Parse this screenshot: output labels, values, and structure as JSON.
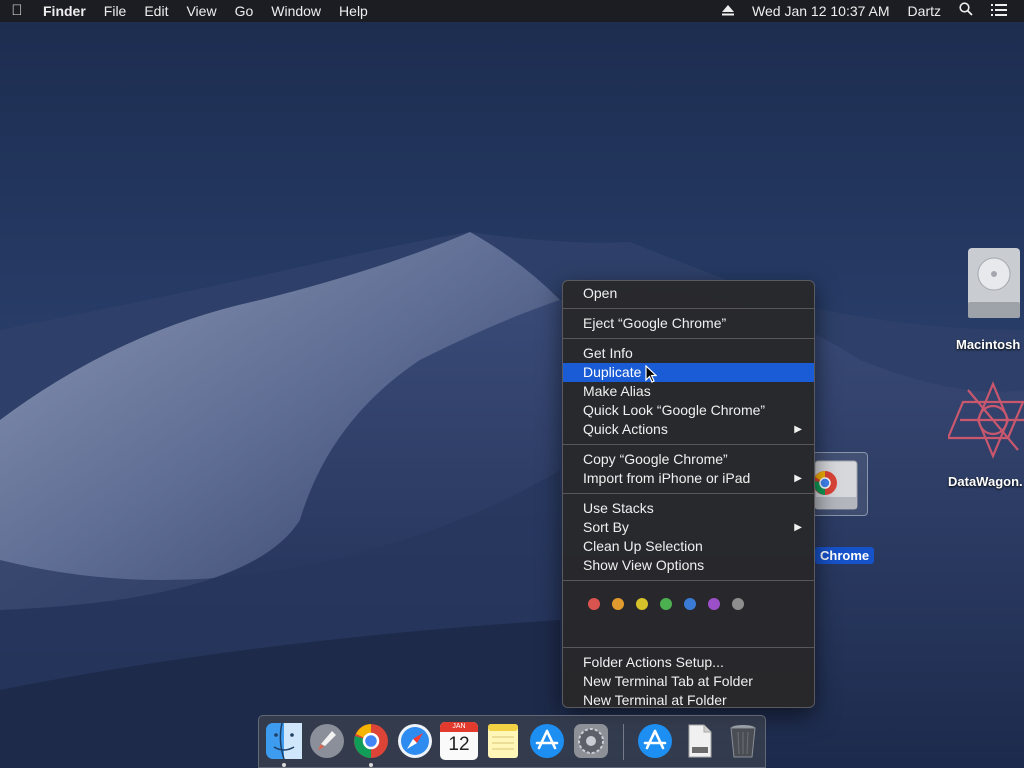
{
  "menubar": {
    "apple_icon": "apple-icon",
    "app_name": "Finder",
    "items": [
      "File",
      "Edit",
      "View",
      "Go",
      "Window",
      "Help"
    ],
    "eject_icon": "eject-icon",
    "datetime": "Wed Jan 12  10:37 AM",
    "user": "Dartz",
    "search_icon": "search-icon",
    "notification_icon": "list-icon"
  },
  "desktop": {
    "icons": [
      {
        "label": "Macintosh",
        "icon": "hard-drive-icon"
      },
      {
        "label": "DataWagon.",
        "icon": "datawagon-icon"
      },
      {
        "label": "Chrome",
        "icon": "chrome-disk-icon",
        "selected": true
      }
    ]
  },
  "context_menu": {
    "open": "Open",
    "eject": "Eject “Google Chrome”",
    "get_info": "Get Info",
    "duplicate": "Duplicate",
    "make_alias": "Make Alias",
    "quick_look": "Quick Look “Google Chrome”",
    "quick_actions": "Quick Actions",
    "copy": "Copy “Google Chrome”",
    "import": "Import from iPhone or iPad",
    "use_stacks": "Use Stacks",
    "sort_by": "Sort By",
    "clean_up": "Clean Up Selection",
    "show_view_options": "Show View Options",
    "tags": [
      "#d9534f",
      "#e09a2d",
      "#d6c22a",
      "#4caf50",
      "#3a7bd5",
      "#9c4fc9",
      "#8e8e8e"
    ],
    "folder_actions": "Folder Actions Setup...",
    "new_terminal_tab": "New Terminal Tab at Folder",
    "new_terminal": "New Terminal at Folder",
    "highlighted": "Duplicate",
    "highlight_color": "#1a5cd6"
  },
  "dock": {
    "apps": [
      "finder-icon",
      "launchpad-icon",
      "chrome-icon",
      "safari-icon",
      "calendar-icon",
      "notes-icon",
      "app-store-icon",
      "system-preferences-icon",
      "app-store-download-icon",
      "document-icon",
      "trash-icon"
    ],
    "calendar_month": "JAN",
    "calendar_day": "12"
  }
}
